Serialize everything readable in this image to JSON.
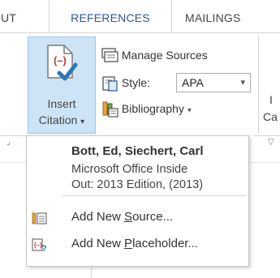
{
  "tabs": [
    "UT",
    "REFERENCES",
    "MAILINGS"
  ],
  "insert_citation": {
    "line1": "Insert",
    "line2": "Citation",
    "arrow": "▾"
  },
  "manage_sources": {
    "label": "Manage Sources"
  },
  "style": {
    "label": "Style:",
    "value": "APA",
    "arrow": "▾"
  },
  "bibliography": {
    "label": "Bibliography",
    "arrow": "▾"
  },
  "cut_off": {
    "top": "I",
    "bottom": "Ca"
  },
  "dropdown": {
    "citation": {
      "author": "Bott, Ed,  Siechert, Carl",
      "title_line1": "Microsoft Office Inside",
      "title_line2": "Out: 2013 Edition, (2013)"
    },
    "add_source": {
      "pre": "Add New ",
      "accel": "S",
      "post": "ource..."
    },
    "add_placeholder": {
      "pre": "Add New ",
      "accel": "P",
      "post": "laceholder..."
    }
  },
  "colors": {
    "accent": "#2b579a",
    "pressed_bg": "#cde4f7",
    "citation_red": "#c0392b"
  }
}
